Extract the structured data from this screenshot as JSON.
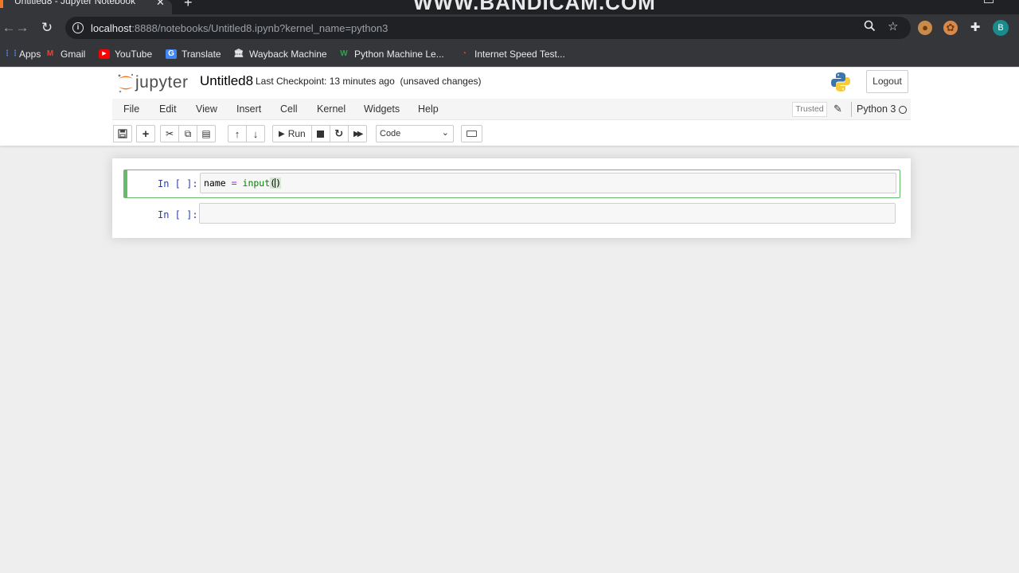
{
  "browser": {
    "tab_title": "Untitled8 - Jupyter Notebook",
    "watermark": "WWW.BANDICAM.COM",
    "url_host": "localhost",
    "url_rest": ":8888/notebooks/Untitled8.ipynb?kernel_name=python3",
    "avatar_letter": "B",
    "bookmarks": [
      {
        "label": "Apps",
        "icon": "apps-grid-icon"
      },
      {
        "label": "Gmail",
        "icon": "gmail-icon"
      },
      {
        "label": "YouTube",
        "icon": "youtube-icon"
      },
      {
        "label": "Translate",
        "icon": "translate-icon"
      },
      {
        "label": "Wayback Machine",
        "icon": "wayback-icon"
      },
      {
        "label": "Python Machine Le...",
        "icon": "python-ml-icon"
      },
      {
        "label": "Internet Speed Test...",
        "icon": "speedtest-icon"
      }
    ]
  },
  "header": {
    "logo_text": "jupyter",
    "notebook_name": "Untitled8",
    "checkpoint": "Last Checkpoint: 13 minutes ago",
    "save_status": "(unsaved changes)",
    "logout_label": "Logout"
  },
  "menubar": {
    "items": [
      "File",
      "Edit",
      "View",
      "Insert",
      "Cell",
      "Kernel",
      "Widgets",
      "Help"
    ],
    "trusted": "Trusted",
    "kernel": "Python 3"
  },
  "toolbar": {
    "run_label": "Run",
    "cell_type": "Code"
  },
  "cells": [
    {
      "prompt": "In [ ]:",
      "code": {
        "var": "name",
        "op": "=",
        "fn": "input",
        "paren_open": "(",
        "paren_close": ")"
      }
    },
    {
      "prompt": "In [ ]:",
      "code": {}
    }
  ],
  "colors": {
    "accent_jupyter": "#f37626",
    "selected_cell_border": "#66bb6a",
    "prompt_color": "#303f9f"
  }
}
